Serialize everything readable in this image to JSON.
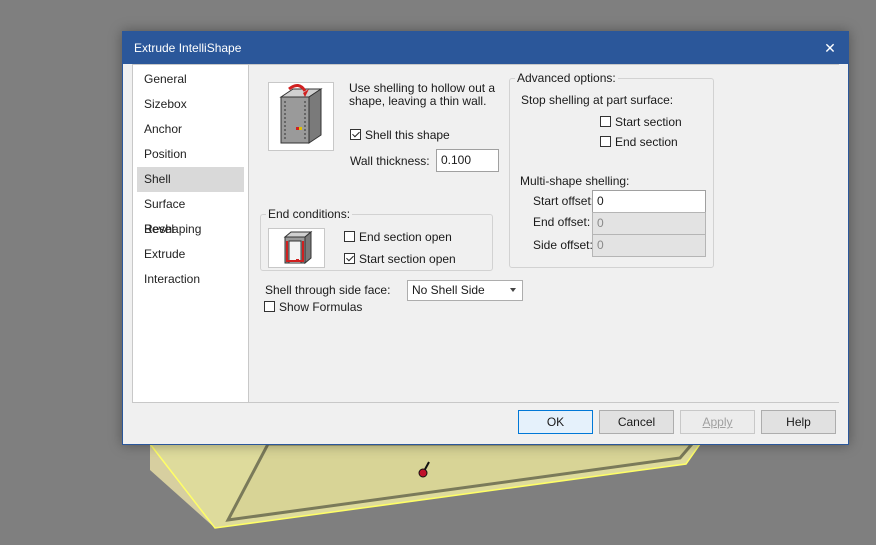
{
  "dialog": {
    "title": "Extrude IntelliShape",
    "close_glyph": "✕"
  },
  "nav": {
    "items": [
      "General",
      "Sizebox",
      "Anchor",
      "Position",
      "Shell",
      "Surface Reshaping",
      "Bevel",
      "Extrude",
      "Interaction"
    ],
    "selected": "Shell"
  },
  "shell": {
    "description": "Use shelling to hollow out a shape, leaving a thin wall.",
    "shell_this_shape_label": "Shell this shape",
    "shell_this_shape_checked": true,
    "wall_thickness_label": "Wall thickness:",
    "wall_thickness_value": "0.100"
  },
  "end_conditions": {
    "title": "End conditions:",
    "end_section_open_label": "End section open",
    "end_section_open_checked": false,
    "start_section_open_label": "Start section open",
    "start_section_open_checked": true
  },
  "shell_side": {
    "label": "Shell through side face:",
    "selected": "No Shell Side",
    "show_formulas_label": "Show Formulas",
    "show_formulas_checked": false
  },
  "advanced": {
    "title": "Advanced options:",
    "stop_label": "Stop shelling at part surface:",
    "start_section_label": "Start section",
    "start_section_checked": false,
    "end_section_label": "End section",
    "end_section_checked": false,
    "multi_label": "Multi-shape shelling:",
    "start_offset_label": "Start offset:",
    "start_offset_value": "0",
    "end_offset_label": "End offset:",
    "end_offset_value": "0",
    "side_offset_label": "Side offset:",
    "side_offset_value": "0"
  },
  "buttons": {
    "ok": "OK",
    "cancel": "Cancel",
    "apply": "Apply",
    "help": "Help"
  },
  "colors": {
    "titlebar": "#2b579a",
    "scene_bg": "#7f7f7f",
    "shape_fill": "#dedb9c",
    "shape_edge": "#ffff66"
  }
}
